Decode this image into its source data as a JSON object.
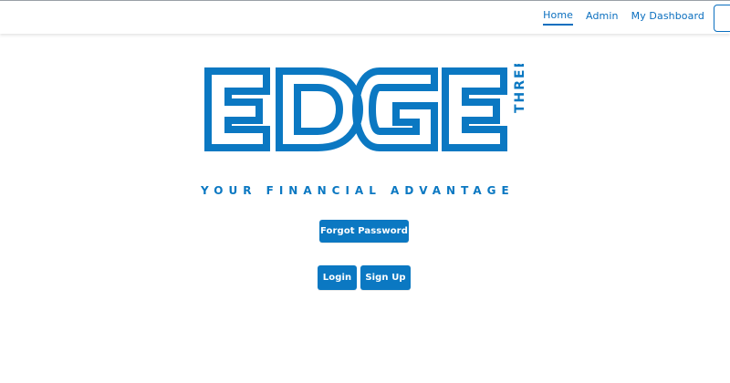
{
  "nav": {
    "items": [
      {
        "label": "Home",
        "active": true
      },
      {
        "label": "Admin",
        "active": false
      },
      {
        "label": "My Dashboard",
        "active": false
      }
    ]
  },
  "logo": {
    "main": "EDGE",
    "side": "THREE SIXTY",
    "tagline": "YOUR FINANCIAL ADVANTAGE",
    "color": "#0b78c2"
  },
  "buttons": {
    "forgot_password": "Forgot Password",
    "login": "Login",
    "sign_up": "Sign Up"
  }
}
